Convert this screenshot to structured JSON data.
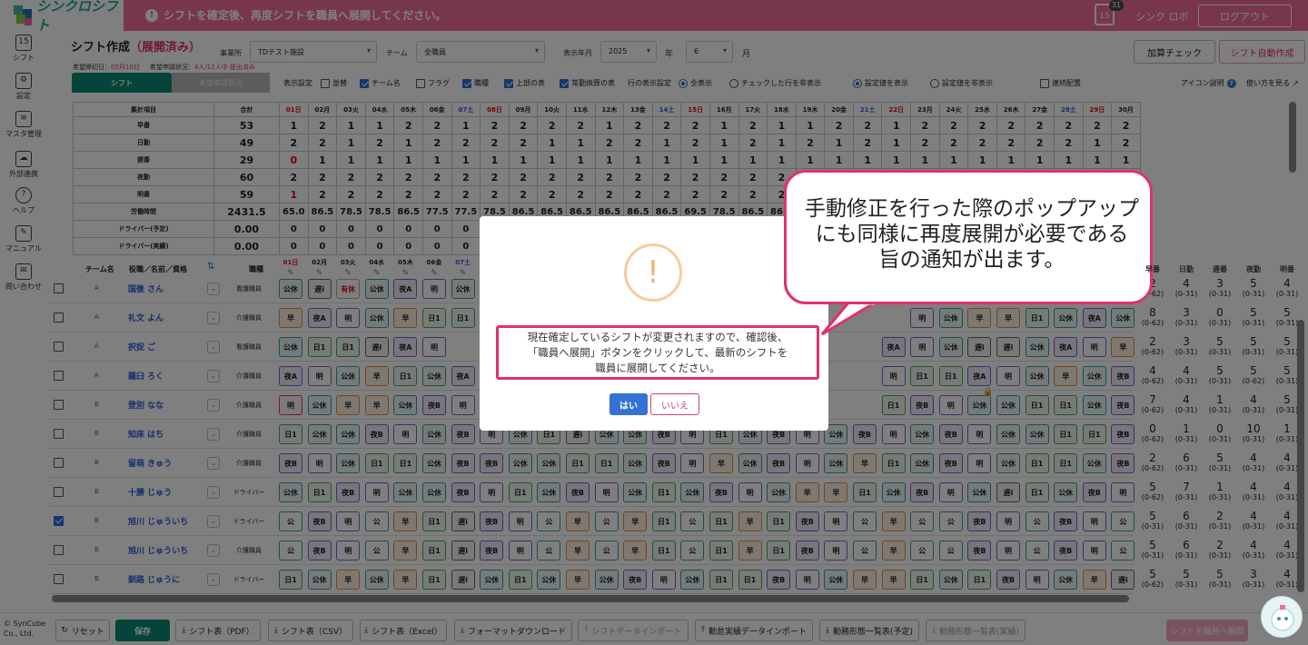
{
  "header": {
    "brand": "シンクロシフト",
    "notice": "シフトを確定後、再度シフトを職員へ展開してください。",
    "cal_day": "15",
    "cal_count": "31",
    "username": "シンク ロボ",
    "logout": "ログアウト"
  },
  "sidebar": [
    {
      "label": "シフト",
      "icon": "calendar-icon",
      "glyph": "15"
    },
    {
      "label": "設定",
      "icon": "gear-icon",
      "glyph": "⚙"
    },
    {
      "label": "マスタ管理",
      "icon": "database-icon",
      "glyph": "≡"
    },
    {
      "label": "外部連携",
      "icon": "cloud-icon",
      "glyph": "☁"
    },
    {
      "label": "ヘルプ",
      "icon": "help-icon",
      "glyph": "?"
    },
    {
      "label": "マニュアル",
      "icon": "manual-icon",
      "glyph": "✎"
    },
    {
      "label": "問い合わせ",
      "icon": "mail-icon",
      "glyph": "✉"
    }
  ],
  "page": {
    "title": "シフト作成",
    "status": "（展開済み）",
    "office_label": "事業所",
    "office_value": "TDテスト施設",
    "team_label": "チーム",
    "team_value": "全職員",
    "ym_label": "表示年月",
    "year_value": "2025",
    "year_unit": "年",
    "month_value": "6",
    "month_unit": "月",
    "deadline_label": "希望締切日：",
    "deadline_value": "05月10日",
    "apply_label": "希望申請状況：",
    "apply_value": "4人/12人中 提出済み",
    "calc_check": "加算チェック",
    "auto_create": "シフト自動作成",
    "icon_help": "アイコン説明",
    "howto": "使い方を見る"
  },
  "tabs": {
    "shift": "シフト",
    "kibou": "希望申請状況"
  },
  "options": {
    "display_label": "表示設定",
    "narabi": "並替",
    "team_name": "チーム名",
    "flag": "フラグ",
    "job": "職種",
    "top_table": "上部の表",
    "fulltime": "常勤換算の表",
    "row_display_label": "行の表示設定",
    "show_all": "全表示",
    "hide_checked": "チェックした行を非表示",
    "show_settings": "設定値を表示",
    "hide_settings": "設定値を非表示",
    "continuous": "連続配置"
  },
  "agg": {
    "head_label": "集計項目",
    "total_label": "合計",
    "days": [
      "01日",
      "02月",
      "03火",
      "04水",
      "05木",
      "06金",
      "07土",
      "08日",
      "09月",
      "10火",
      "11水",
      "12木",
      "13金",
      "14土",
      "15日",
      "16月",
      "17火",
      "18水",
      "19木",
      "20金",
      "21土",
      "22日",
      "23月",
      "24火",
      "25水",
      "26木",
      "27金",
      "28土",
      "29日",
      "30月"
    ],
    "rows": [
      {
        "label": "早番",
        "total": "53",
        "vals": [
          "1",
          "2",
          "1",
          "1",
          "2",
          "2",
          "1",
          "2",
          "2",
          "2",
          "2",
          "1",
          "2",
          "2",
          "2",
          "1",
          "2",
          "1",
          "1",
          "2",
          "2",
          "1",
          "2",
          "2",
          "2",
          "2",
          "2",
          "2",
          "2",
          "2"
        ]
      },
      {
        "label": "日勤",
        "total": "49",
        "vals": [
          "2",
          "2",
          "1",
          "2",
          "1",
          "2",
          "2",
          "2",
          "2",
          "1",
          "1",
          "2",
          "2",
          "1",
          "2",
          "1",
          "2",
          "1",
          "2",
          "1",
          "2",
          "1",
          "2",
          "2",
          "2",
          "2",
          "2",
          "2",
          "1",
          "2"
        ]
      },
      {
        "label": "遅番",
        "total": "29",
        "vals": [
          "0",
          "1",
          "1",
          "1",
          "1",
          "1",
          "1",
          "1",
          "1",
          "1",
          "1",
          "1",
          "1",
          "1",
          "1",
          "1",
          "1",
          "1",
          "1",
          "1",
          "1",
          "1",
          "1",
          "1",
          "1",
          "1",
          "1",
          "1",
          "1",
          "1"
        ]
      },
      {
        "label": "夜勤",
        "total": "60",
        "vals": [
          "2",
          "2",
          "2",
          "2",
          "2",
          "2",
          "2",
          "2",
          "2",
          "2",
          "2",
          "2",
          "2",
          "2",
          "2",
          "2",
          "2",
          "2",
          "2",
          "2",
          "2",
          "2",
          "2",
          "2",
          "2",
          "2",
          "2",
          "2",
          "2",
          "2"
        ]
      },
      {
        "label": "明番",
        "total": "59",
        "vals": [
          "1",
          "2",
          "2",
          "2",
          "2",
          "2",
          "2",
          "2",
          "2",
          "2",
          "2",
          "2",
          "2",
          "2",
          "2",
          "2",
          "2",
          "2",
          "2",
          "2",
          "2",
          "2",
          "2",
          "2",
          "2",
          "2",
          "2",
          "2",
          "2",
          "2"
        ]
      },
      {
        "label": "労働時間",
        "total": "2431.5",
        "vals": [
          "65.0",
          "86.5",
          "78.5",
          "78.5",
          "86.5",
          "77.5",
          "77.5",
          "78.5",
          "86.5",
          "86.5",
          "86.5",
          "86.5",
          "86.5",
          "86.5",
          "69.5",
          "78.5",
          "86.5",
          "86.5",
          "",
          "",
          "",
          "",
          "",
          "",
          "",
          "",
          "",
          "",
          "",
          ""
        ]
      },
      {
        "label": "ドライバー(予定)",
        "total": "0.00",
        "vals": [
          "0",
          "0",
          "0",
          "0",
          "0",
          "0",
          "0",
          "",
          "",
          "",
          "",
          "",
          "",
          "",
          "",
          "",
          "",
          "",
          "",
          "",
          "",
          "",
          "",
          "",
          "",
          "",
          "",
          "",
          "",
          ""
        ]
      },
      {
        "label": "ドライバー(実績)",
        "total": "0.00",
        "vals": [
          "0",
          "0",
          "0",
          "0",
          "0",
          "0",
          "0",
          "",
          "",
          "",
          "",
          "",
          "",
          "",
          "",
          "",
          "",
          "",
          "",
          "",
          "",
          "",
          "",
          "",
          "",
          "",
          "",
          "",
          "",
          ""
        ]
      }
    ]
  },
  "staff_header": {
    "team": "チーム名",
    "name": "役職／名前／資格",
    "job": "職種",
    "sum": [
      "早番",
      "日勤",
      "遅番",
      "夜勤",
      "明番"
    ]
  },
  "staff": [
    {
      "team": "A",
      "name": "国後 さん",
      "job": "看護職員",
      "checked": false,
      "shifts": [
        "公休",
        "遅i",
        "有休",
        "公休",
        "夜A",
        "明",
        "公休",
        "",
        "",
        "",
        "",
        "",
        "",
        "",
        "",
        "",
        "",
        "",
        "",
        "",
        "",
        "",
        "",
        "",
        "",
        "",
        "",
        "",
        "",
        ""
      ],
      "sums": [
        [
          "2",
          "(0-62)"
        ],
        [
          "4",
          "(0-31)"
        ],
        [
          "3",
          "(0-31)"
        ],
        [
          "5",
          "(0-31)"
        ],
        [
          "4",
          "(0-31)"
        ]
      ]
    },
    {
      "team": "A",
      "name": "礼文 よん",
      "job": "介護職員",
      "checked": false,
      "shifts": [
        "早",
        "夜A",
        "明",
        "公休",
        "早",
        "日1",
        "日1",
        "",
        "",
        "",
        "",
        "",
        "",
        "",
        "",
        "",
        "",
        "",
        "",
        "",
        "",
        "",
        "明",
        "公休",
        "早",
        "早",
        "日1",
        "公休",
        "夜A",
        "公休"
      ],
      "sums": [
        [
          "8",
          "(0-62)"
        ],
        [
          "3",
          "(0-31)"
        ],
        [
          "0",
          "(0-31)"
        ],
        [
          "5",
          "(0-31)"
        ],
        [
          "5",
          "(0-31)"
        ]
      ]
    },
    {
      "team": "A",
      "name": "択捉 ご",
      "job": "看護職員",
      "checked": false,
      "shifts": [
        "公休",
        "日1",
        "日1",
        "遅i",
        "夜A",
        "明",
        "",
        "",
        "",
        "",
        "",
        "",
        "",
        "",
        "",
        "",
        "",
        "",
        "",
        "",
        "",
        "夜A",
        "明",
        "公休",
        "遅i",
        "遅i",
        "公休",
        "夜A",
        "明",
        "早"
      ],
      "sums": [
        [
          "2",
          "(0-62)"
        ],
        [
          "3",
          "(0-31)"
        ],
        [
          "5",
          "(0-31)"
        ],
        [
          "5",
          "(0-31)"
        ],
        [
          "5",
          "(0-31)"
        ]
      ]
    },
    {
      "team": "A",
      "name": "羅臼 ろく",
      "job": "介護職員",
      "checked": false,
      "shifts": [
        "夜A",
        "明",
        "公休",
        "早",
        "日1",
        "公休",
        "夜A",
        "",
        "",
        "",
        "",
        "",
        "",
        "",
        "",
        "",
        "",
        "",
        "",
        "",
        "",
        "明",
        "日1",
        "日1",
        "夜A",
        "明",
        "公休",
        "早",
        "公休",
        "夜B"
      ],
      "sums": [
        [
          "4",
          "(0-62)"
        ],
        [
          "4",
          "(0-31)"
        ],
        [
          "5",
          "(0-31)"
        ],
        [
          "5",
          "(0-62)"
        ],
        [
          "5",
          "(0-31)"
        ]
      ]
    },
    {
      "team": "B",
      "name": "登別 なな",
      "job": "介護職員",
      "checked": false,
      "shifts": [
        "明",
        "公休",
        "早",
        "早",
        "公休",
        "夜B",
        "明",
        "",
        "",
        "",
        "",
        "",
        "",
        "",
        "",
        "",
        "",
        "",
        "",
        "",
        "",
        "日1",
        "夜B",
        "明",
        "公休",
        "公休",
        "日1",
        "日1",
        "公休",
        "夜B"
      ],
      "sums": [
        [
          "7",
          "(0-62)"
        ],
        [
          "4",
          "(0-31)"
        ],
        [
          "1",
          "(0-31)"
        ],
        [
          "4",
          "(0-31)"
        ],
        [
          "5",
          "(0-31)"
        ]
      ]
    },
    {
      "team": "B",
      "name": "知床 はち",
      "job": "介護職員",
      "checked": false,
      "shifts": [
        "日1",
        "公休",
        "公休",
        "夜B",
        "明",
        "公休",
        "夜B",
        "明",
        "公休",
        "日1",
        "遅i",
        "公休",
        "公休",
        "夜B",
        "明",
        "日1",
        "公休",
        "夜B",
        "明",
        "公休",
        "夜B",
        "明",
        "公休",
        "夜B",
        "明",
        "公休",
        "公休",
        "日1",
        "日1",
        "夜B"
      ],
      "sums": [
        [
          "0",
          "(0-62)"
        ],
        [
          "1",
          "(0-31)"
        ],
        [
          "0",
          "(0-31)"
        ],
        [
          "10",
          "(0-31)"
        ],
        [
          "1",
          "(0-31)"
        ]
      ]
    },
    {
      "team": "B",
      "name": "留萌 きゅう",
      "job": "介護職員",
      "checked": false,
      "shifts": [
        "夜B",
        "明",
        "公休",
        "日1",
        "日1",
        "公休",
        "夜B",
        "夜B",
        "公休",
        "公休",
        "日1",
        "日1",
        "公休",
        "夜B",
        "明",
        "早",
        "公休",
        "夜B",
        "明",
        "公休",
        "早",
        "日1",
        "公休",
        "夜B",
        "明",
        "公休",
        "日1",
        "日1",
        "公休",
        "夜B"
      ],
      "sums": [
        [
          "2",
          "(0-62)"
        ],
        [
          "6",
          "(0-31)"
        ],
        [
          "5",
          "(0-31)"
        ],
        [
          "4",
          "(0-31)"
        ],
        [
          "4",
          "(0-31)"
        ]
      ]
    },
    {
      "team": "B",
      "name": "十勝 じゅう",
      "job": "ドライバー",
      "checked": false,
      "shifts": [
        "公休",
        "日1",
        "夜B",
        "明",
        "公休",
        "公休",
        "夜B",
        "明",
        "日1",
        "公休",
        "夜B",
        "明",
        "公休",
        "日1",
        "公休",
        "夜B",
        "明",
        "公休",
        "早",
        "早",
        "日1",
        "公休",
        "夜B",
        "明",
        "公休",
        "遅i",
        "日1",
        "公休",
        "夜B",
        "明"
      ],
      "sums": [
        [
          "5",
          "(0-62)"
        ],
        [
          "7",
          "(0-31)"
        ],
        [
          "1",
          "(0-31)"
        ],
        [
          "4",
          "(0-31)"
        ],
        [
          "4",
          "(0-31)"
        ]
      ]
    },
    {
      "team": "B",
      "name": "旭川 じゅういち",
      "job": "ドライバー",
      "checked": true,
      "shifts": [
        "公",
        "夜B",
        "明",
        "公",
        "早",
        "日1",
        "遅i",
        "夜B",
        "明",
        "公",
        "早",
        "公",
        "早",
        "日1",
        "公",
        "日1",
        "早",
        "日1",
        "夜B",
        "明",
        "公",
        "早",
        "公",
        "公",
        "夜B",
        "明",
        "公",
        "夜B",
        "明",
        "公"
      ],
      "sums": [
        [
          "5",
          "(0-31)"
        ],
        [
          "6",
          "(0-31)"
        ],
        [
          "2",
          "(0-31)"
        ],
        [
          "4",
          "(0-31)"
        ],
        [
          "4",
          "(0-31)"
        ]
      ]
    },
    {
      "team": "B",
      "name": "旭川 じゅういち",
      "job": "介護職員",
      "checked": false,
      "shifts": [
        "公",
        "夜B",
        "明",
        "公",
        "早",
        "日1",
        "遅i",
        "夜B",
        "明",
        "公",
        "早",
        "公",
        "早",
        "日1",
        "公",
        "日1",
        "早",
        "日1",
        "夜B",
        "明",
        "公",
        "早",
        "公",
        "公",
        "夜B",
        "明",
        "公",
        "夜B",
        "明",
        "公"
      ],
      "sums": [
        [
          "5",
          "(0-31)"
        ],
        [
          "6",
          "(0-31)"
        ],
        [
          "2",
          "(0-31)"
        ],
        [
          "4",
          "(0-31)"
        ],
        [
          "4",
          "(0-31)"
        ]
      ]
    },
    {
      "team": "B",
      "name": "釧路 じゅうに",
      "job": "ドライバー",
      "checked": false,
      "shifts": [
        "日1",
        "公休",
        "早",
        "公休",
        "早",
        "日1",
        "遅i",
        "公休",
        "日1",
        "公休",
        "早",
        "公休",
        "夜B",
        "明",
        "公休",
        "日1",
        "日1",
        "夜B",
        "明",
        "公休",
        "早",
        "早",
        "日1",
        "公休",
        "日1",
        "夜B",
        "明",
        "公休",
        "早",
        "遅i"
      ],
      "sums": [
        [
          "5",
          "(0-62)"
        ],
        [
          "5",
          "(0-31)"
        ],
        [
          "5",
          "(0-31)"
        ],
        [
          "3",
          "(0-31)"
        ],
        [
          "4",
          "(0-31)"
        ]
      ]
    }
  ],
  "footer": {
    "copyright": "© SynCube Co., Ltd.",
    "reset": "リセット",
    "save": "保存",
    "pdf": "シフト表（PDF）",
    "csv": "シフト表（CSV）",
    "excel": "シフト表（Excel）",
    "format_dl": "フォーマットダウンロード",
    "import": "シフトデータインポート",
    "attendance_import": "勤怠実績データインポート",
    "list_plan": "勤務形態一覧表(予定)",
    "list_actual": "勤務形態一覧表(実績)",
    "deploy": "シフトを職員へ展開"
  },
  "modal": {
    "icon": "!",
    "message_lines": [
      "現在確定しているシフトが変更されますので、確認後、",
      "「職員へ展開」ボタンをクリックして、最新のシフトを",
      "職員に展開してください。"
    ],
    "yes": "はい",
    "no": "いいえ"
  },
  "callout": {
    "lines": [
      "手動修正を行った際のポップアップ",
      "にも同様に再度展開が必要である",
      "旨の通知が出ます。"
    ]
  },
  "colors": {
    "brand_pink": "#ef6d96",
    "accent_teal": "#0a8a72",
    "primary_blue": "#3472d4",
    "highlight_red": "#e2306a"
  }
}
